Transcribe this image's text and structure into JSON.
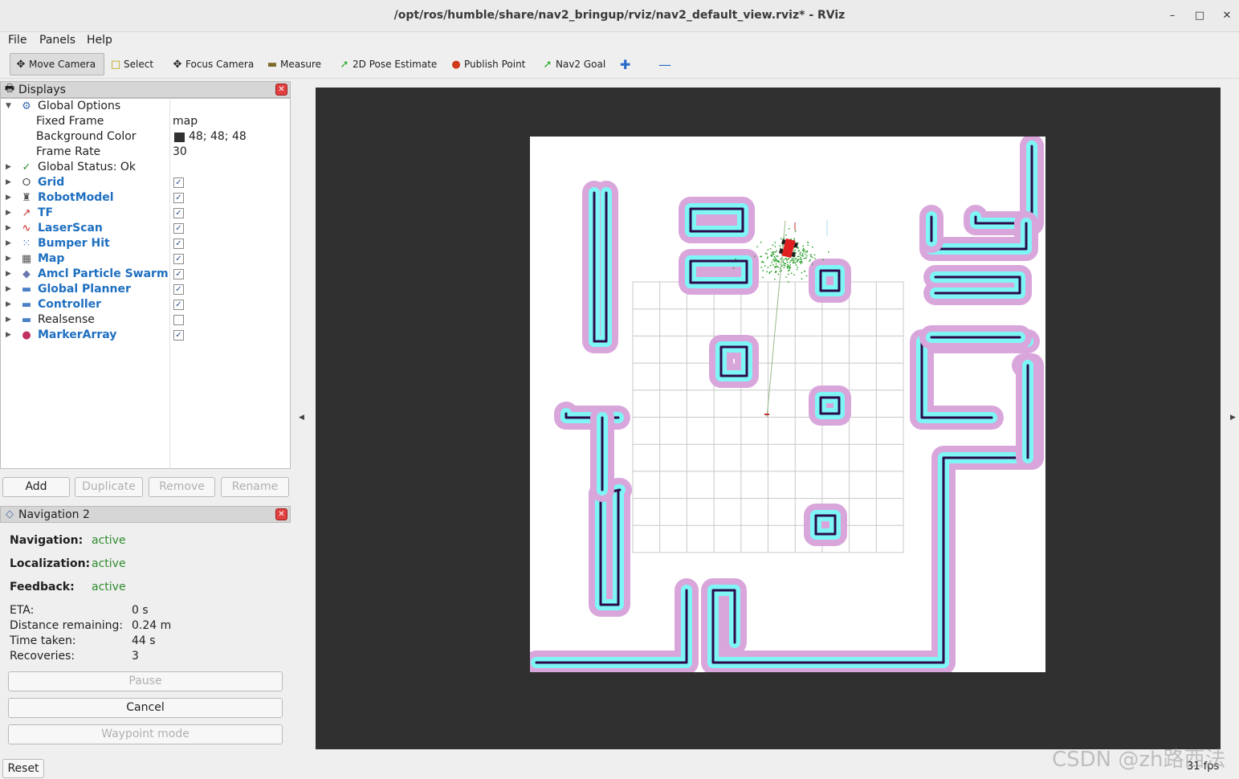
{
  "window": {
    "title": "/opt/ros/humble/share/nav2_bringup/rviz/nav2_default_view.rviz* - RViz"
  },
  "menu": {
    "file": "File",
    "panels": "Panels",
    "help": "Help"
  },
  "toolbar": {
    "move_camera": "Move Camera",
    "select": "Select",
    "focus_camera": "Focus Camera",
    "measure": "Measure",
    "pose_estimate": "2D Pose Estimate",
    "publish_point": "Publish Point",
    "nav2_goal": "Nav2 Goal"
  },
  "displays": {
    "header": "Displays",
    "global_options": {
      "label": "Global Options",
      "fixed_frame_label": "Fixed Frame",
      "fixed_frame_value": "map",
      "bg_color_label": "Background Color",
      "bg_color_value": "48; 48; 48",
      "bg_color_hex": "#303030",
      "frame_rate_label": "Frame Rate",
      "frame_rate_value": "30"
    },
    "global_status": "Global Status: Ok",
    "items": [
      {
        "label": "Grid",
        "checked": true,
        "icon": "grid-icon"
      },
      {
        "label": "RobotModel",
        "checked": true,
        "icon": "robot-icon"
      },
      {
        "label": "TF",
        "checked": true,
        "icon": "tf-axes-icon"
      },
      {
        "label": "LaserScan",
        "checked": true,
        "icon": "laser-icon"
      },
      {
        "label": "Bumper Hit",
        "checked": true,
        "icon": "points-icon"
      },
      {
        "label": "Map",
        "checked": true,
        "icon": "map-icon"
      },
      {
        "label": "Amcl Particle Swarm",
        "checked": true,
        "icon": "pose-array-icon"
      },
      {
        "label": "Global Planner",
        "checked": true,
        "icon": "folder-icon"
      },
      {
        "label": "Controller",
        "checked": true,
        "icon": "folder-icon"
      },
      {
        "label": "Realsense",
        "checked": false,
        "icon": "folder-icon"
      },
      {
        "label": "MarkerArray",
        "checked": true,
        "icon": "markers-icon"
      }
    ],
    "buttons": {
      "add": "Add",
      "duplicate": "Duplicate",
      "remove": "Remove",
      "rename": "Rename"
    }
  },
  "navigation": {
    "header": "Navigation 2",
    "navigation_label": "Navigation:",
    "navigation_value": "active",
    "localization_label": "Localization:",
    "localization_value": "active",
    "feedback_label": "Feedback:",
    "feedback_value": "active",
    "eta_label": "ETA:",
    "eta_value": "0 s",
    "distance_label": "Distance remaining:",
    "distance_value": "0.24 m",
    "time_label": "Time taken:",
    "time_value": "44 s",
    "recoveries_label": "Recoveries:",
    "recoveries_value": "3",
    "pause": "Pause",
    "cancel": "Cancel",
    "waypoint": "Waypoint mode"
  },
  "status": {
    "reset": "Reset",
    "fps": "31 fps"
  },
  "watermark": "CSDN @zh路西法",
  "colors": {
    "viewport_bg": "#303030",
    "map_free": "#ffffff",
    "costmap_inflation": "#d9a6dc",
    "costmap_inscribed": "#7ff6f6",
    "obstacle": "#2a0a4a",
    "accent_blue": "#1e6fc0",
    "status_green": "#2e8b2e"
  }
}
